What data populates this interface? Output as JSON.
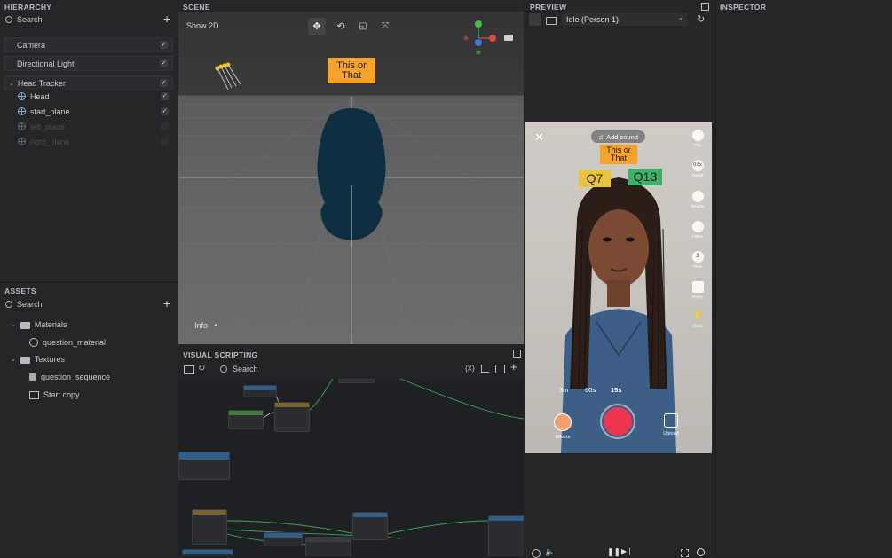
{
  "hierarchy": {
    "title": "HIERARCHY",
    "search_placeholder": "Search",
    "items": [
      {
        "label": "Camera"
      },
      {
        "label": "Directional Light"
      },
      {
        "label": "Head Tracker"
      },
      {
        "label": "Head"
      },
      {
        "label": "start_plane"
      },
      {
        "label": "left_plane"
      },
      {
        "label": "right_plane"
      }
    ]
  },
  "assets": {
    "title": "ASSETS",
    "search_placeholder": "Search",
    "items": [
      {
        "label": "Materials"
      },
      {
        "label": "question_material"
      },
      {
        "label": "Textures"
      },
      {
        "label": "question_sequence"
      },
      {
        "label": "Start copy"
      }
    ]
  },
  "scene": {
    "title": "SCENE",
    "show2d": "Show 2D",
    "sign_text": "This or That",
    "info_label": "Info"
  },
  "visual_scripting": {
    "title": "VISUAL SCRIPTING",
    "search_placeholder": "Search",
    "var_button": "{X}"
  },
  "preview": {
    "title": "PREVIEW",
    "mode": "Idle (Person 1)",
    "add_sound": "Add sound",
    "sign_text": "This or That",
    "q_left": "Q7",
    "q_right": "Q13",
    "right_buttons": [
      {
        "label": "Flip"
      },
      {
        "label": "Speed",
        "badge": "0.5x"
      },
      {
        "label": "Beauty"
      },
      {
        "label": "Filters"
      },
      {
        "label": "Timer",
        "badge": "3"
      },
      {
        "label": "Reply"
      },
      {
        "label": "Flash"
      }
    ],
    "durations": [
      "3m",
      "60s",
      "15s"
    ],
    "effects_label": "Effects",
    "upload_label": "Upload"
  },
  "inspector": {
    "title": "INSPECTOR"
  },
  "colors": {
    "accent_orange": "#f5a32a",
    "record_red": "#f0344f",
    "q_green": "#3fb06a",
    "q_yellow": "#e8c43a",
    "head_navy": "#0e2f3f"
  }
}
